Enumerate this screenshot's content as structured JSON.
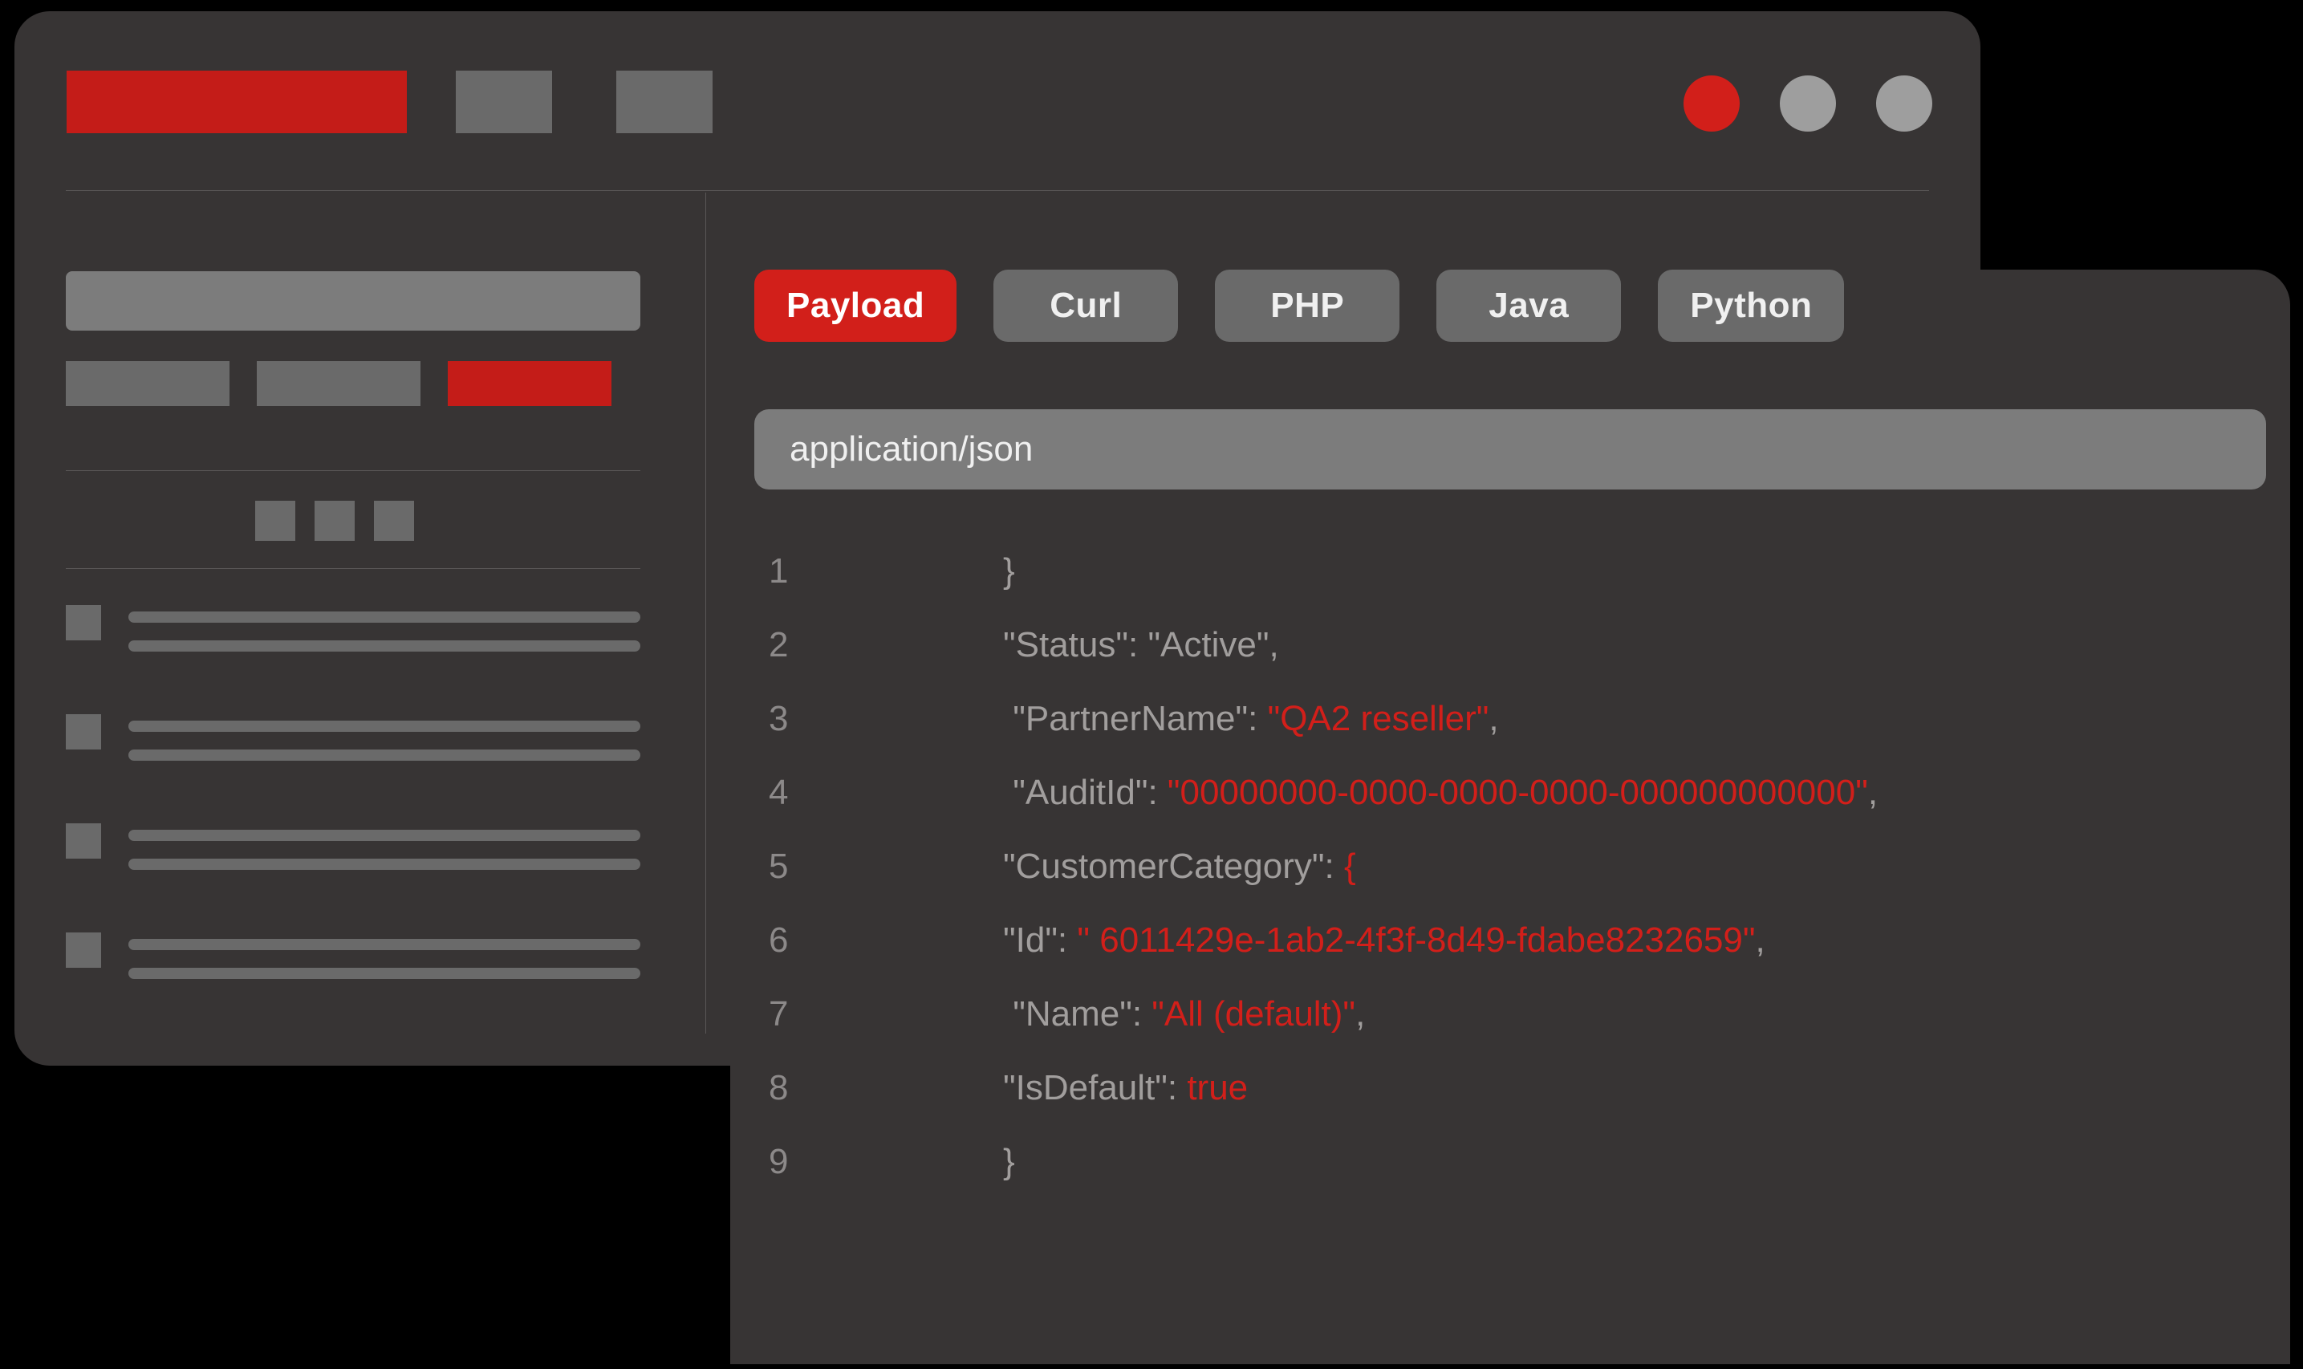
{
  "titlebar": {
    "dots": [
      "accent",
      "grey",
      "grey"
    ]
  },
  "sidebar": {
    "chips": [
      "",
      "",
      ""
    ],
    "chip_accent_index": 2,
    "squares": 3,
    "items": 4
  },
  "tabs": [
    {
      "label": "Payload",
      "active": true
    },
    {
      "label": "Curl",
      "active": false
    },
    {
      "label": "PHP",
      "active": false
    },
    {
      "label": "Java",
      "active": false
    },
    {
      "label": "Python",
      "active": false
    }
  ],
  "content_type": "application/json",
  "code": {
    "lines": [
      {
        "n": "1",
        "keyPrefix": "",
        "key": "",
        "keySuffix": "",
        "value": "",
        "valueSuffix": "",
        "tail": "}",
        "indent": "            "
      },
      {
        "n": "2",
        "keyPrefix": "\"",
        "key": "Status",
        "keySuffix": "\": ",
        "value": "\"Active\"",
        "valueIsRed": false,
        "tail": ",",
        "indent": "            "
      },
      {
        "n": "3",
        "keyPrefix": " \"",
        "key": "PartnerName",
        "keySuffix": "\": ",
        "value": "\"QA2 reseller\"",
        "valueIsRed": true,
        "tail": ",",
        "indent": "            "
      },
      {
        "n": "4",
        "keyPrefix": " \"",
        "key": "AuditId",
        "keySuffix": "\": ",
        "value": "\"00000000-0000-0000-0000-000000000000\"",
        "valueIsRed": true,
        "tail": ",",
        "indent": "            "
      },
      {
        "n": "5",
        "keyPrefix": "\"",
        "key": "CustomerCategory",
        "keySuffix": "\": ",
        "value": "{",
        "valueIsRed": true,
        "tail": "",
        "indent": "            "
      },
      {
        "n": "6",
        "keyPrefix": "\"",
        "key": "Id",
        "keySuffix": "\": ",
        "value": "\" 6011429e-1ab2-4f3f-8d49-fdabe8232659\"",
        "valueIsRed": true,
        "tail": ",",
        "indent": "            "
      },
      {
        "n": "7",
        "keyPrefix": " \"",
        "key": "Name",
        "keySuffix": "\": ",
        "value": "\"All (default)\"",
        "valueIsRed": true,
        "tail": ",",
        "indent": "            "
      },
      {
        "n": "8",
        "keyPrefix": "\"",
        "key": "IsDefault",
        "keySuffix": "\": ",
        "value": "true",
        "valueIsRed": true,
        "tail": "",
        "indent": "            "
      },
      {
        "n": "9",
        "keyPrefix": "",
        "key": "",
        "keySuffix": "",
        "value": "",
        "valueSuffix": "",
        "tail": "}",
        "indent": "            "
      }
    ]
  }
}
